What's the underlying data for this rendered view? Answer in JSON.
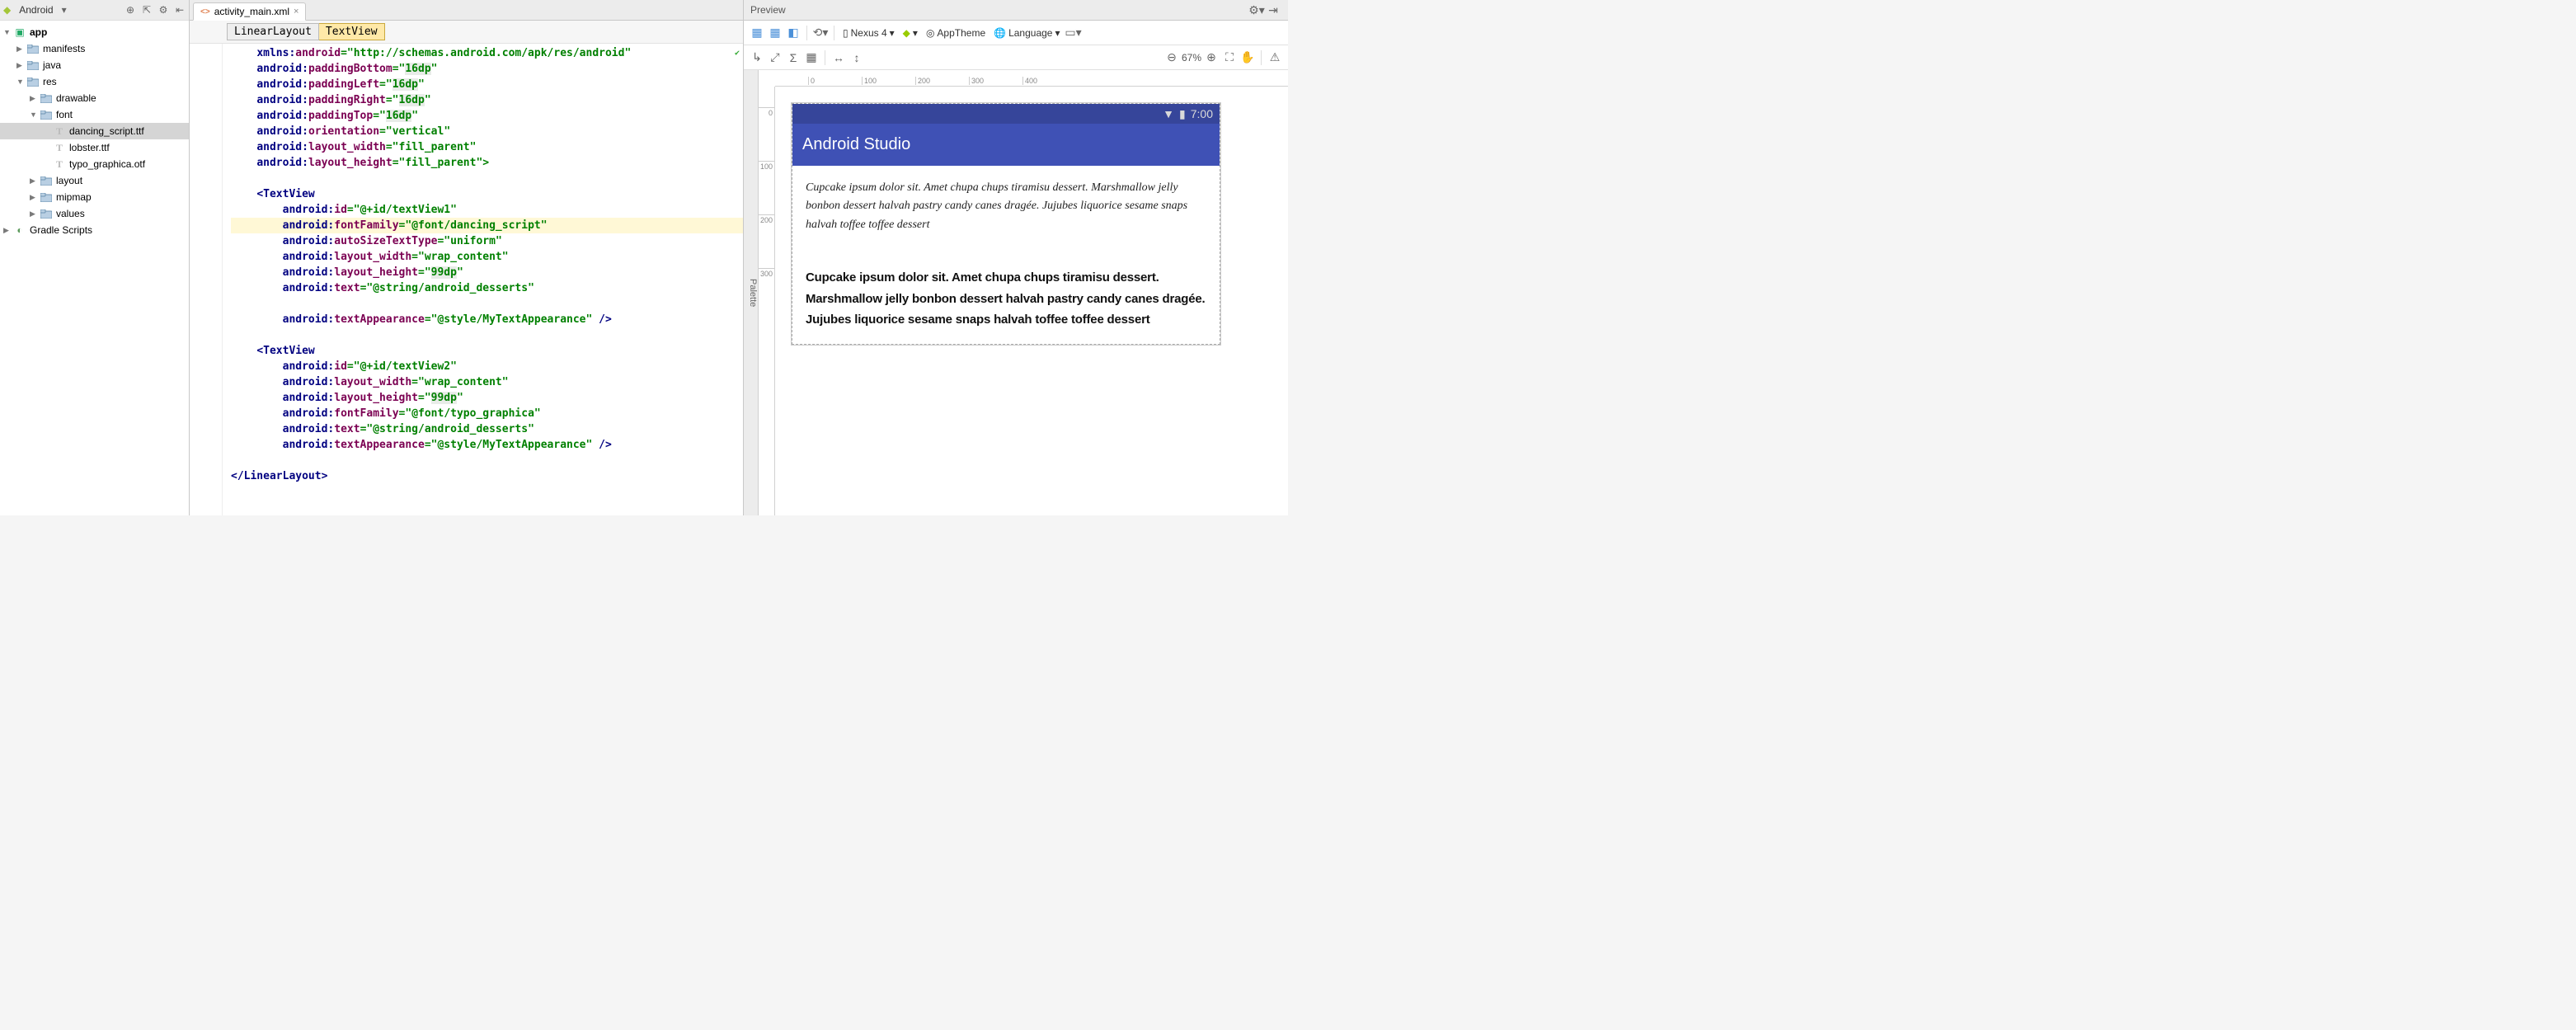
{
  "project": {
    "viewLabel": "Android",
    "tree": {
      "root": "app",
      "folders": {
        "manifests": "manifests",
        "java": "java",
        "res": "res",
        "drawable": "drawable",
        "font": "font",
        "layout": "layout",
        "mipmap": "mipmap",
        "values": "values"
      },
      "fontFiles": [
        "dancing_script.ttf",
        "lobster.ttf",
        "typo_graphica.otf"
      ],
      "gradle": "Gradle Scripts"
    }
  },
  "editor": {
    "tabName": "activity_main.xml",
    "breadcrumbs": [
      "LinearLayout",
      "TextView"
    ],
    "code": {
      "l1_ns": "xmlns:",
      "l1_attr": "android",
      "l1_val": "http://schemas.android.com/apk/res/android",
      "pb_a": "android:",
      "pb_k": "paddingBottom",
      "pb_v": "16dp",
      "pl_a": "android:",
      "pl_k": "paddingLeft",
      "pl_v": "16dp",
      "pr_a": "android:",
      "pr_k": "paddingRight",
      "pr_v": "16dp",
      "pt_a": "android:",
      "pt_k": "paddingTop",
      "pt_v": "16dp",
      "or_a": "android:",
      "or_k": "orientation",
      "or_v": "vertical",
      "lw_a": "android:",
      "lw_k": "layout_width",
      "lw_v": "fill_parent",
      "lh_a": "android:",
      "lh_k": "layout_height",
      "lh_v": "fill_parent",
      "tv_open": "<TextView",
      "id1_a": "android:",
      "id1_k": "id",
      "id1_v": "@+id/textView1",
      "ff1_a": "android:",
      "ff1_k": "fontFamily",
      "ff1_v": "@font/dancing_script",
      "as1_a": "android:",
      "as1_k": "autoSizeTextType",
      "as1_v": "uniform",
      "lw1_a": "android:",
      "lw1_k": "layout_width",
      "lw1_v": "wrap_content",
      "lh1_a": "android:",
      "lh1_k": "layout_height",
      "lh1_v": "99dp",
      "tx1_a": "android:",
      "tx1_k": "text",
      "tx1_v": "@string/android_desserts",
      "ta1_a": "android:",
      "ta1_k": "textAppearance",
      "ta1_v": "@style/MyTextAppearance",
      "close_self": " />",
      "id2_a": "android:",
      "id2_k": "id",
      "id2_v": "@+id/textView2",
      "lw2_a": "android:",
      "lw2_k": "layout_width",
      "lw2_v": "wrap_content",
      "lh2_a": "android:",
      "lh2_k": "layout_height",
      "lh2_v": "99dp",
      "ff2_a": "android:",
      "ff2_k": "fontFamily",
      "ff2_v": "@font/typo_graphica",
      "tx2_a": "android:",
      "tx2_k": "text",
      "tx2_v": "@string/android_desserts",
      "ta2_a": "android:",
      "ta2_k": "textAppearance",
      "ta2_v": "@style/MyTextAppearance",
      "ll_close": "</LinearLayout>"
    }
  },
  "preview": {
    "title": "Preview",
    "paletteLabel": "Palette",
    "deviceName": "Nexus 4",
    "apiDropLabel": "",
    "themeLabel": "AppTheme",
    "languageLabel": "Language",
    "zoom": "67%",
    "rulerH": [
      "0",
      "100",
      "200",
      "300",
      "400"
    ],
    "rulerV": [
      "0",
      "100",
      "200",
      "300"
    ],
    "statusTime": "7:00",
    "appBarTitle": "Android Studio",
    "textview1": "Cupcake ipsum dolor sit. Amet chupa chups tiramisu dessert. Marshmallow jelly bonbon dessert halvah pastry candy canes dragée. Jujubes liquorice sesame snaps halvah toffee toffee dessert",
    "textview2": "Cupcake ipsum dolor sit. Amet chupa chups tiramisu dessert. Marshmallow jelly bonbon dessert halvah pastry candy canes dragée. Jujubes liquorice sesame snaps halvah toffee toffee dessert"
  }
}
